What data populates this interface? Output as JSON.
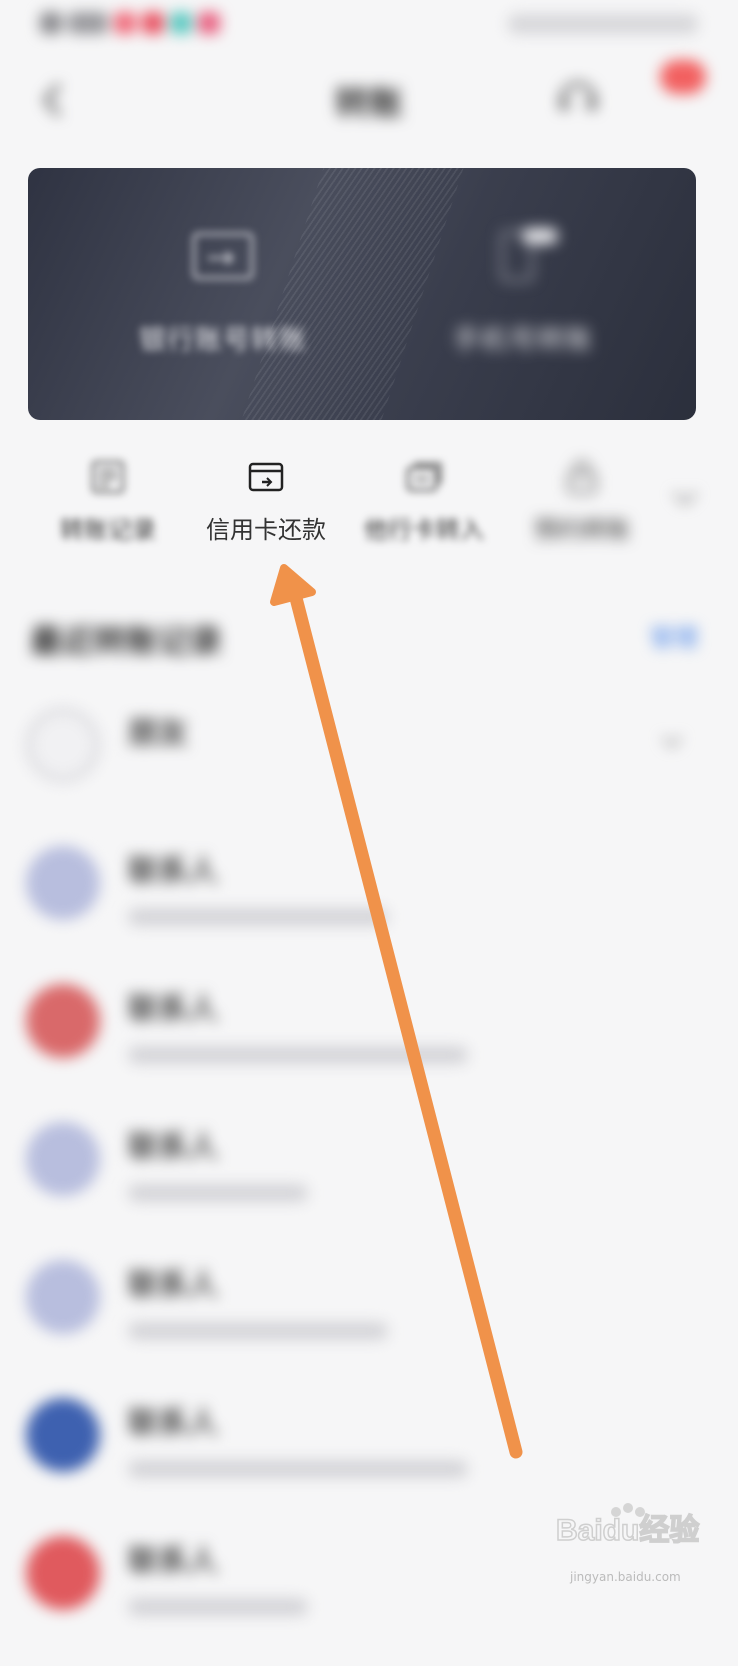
{
  "nav": {
    "title": "转账"
  },
  "banner": {
    "cards": [
      {
        "label": "银行账号转账",
        "icon": "card-transfer-icon"
      },
      {
        "label": "手机号转账",
        "icon": "phone-transfer-icon"
      }
    ]
  },
  "quick_actions": [
    {
      "label": "转账记录",
      "icon": "document-list-icon"
    },
    {
      "label": "信用卡还款",
      "icon": "credit-card-icon"
    },
    {
      "label": "他行卡转入",
      "icon": "card-swap-icon"
    },
    {
      "label": "预约转账",
      "icon": "lock-icon"
    }
  ],
  "recent": {
    "title": "最近转账记录",
    "manage_label": "管理"
  },
  "payees": [
    {
      "name": "朋友",
      "sub": "",
      "avatar_color": "#f1f1f3",
      "type": "group"
    },
    {
      "name": "联系人",
      "sub": "",
      "avatar_color": "#b8bede"
    },
    {
      "name": "联系人",
      "sub": "",
      "avatar_color": "#d9696a"
    },
    {
      "name": "联系人",
      "sub": "",
      "avatar_color": "#b8bede"
    },
    {
      "name": "联系人",
      "sub": "",
      "avatar_color": "#b8bede"
    },
    {
      "name": "联系人",
      "sub": "",
      "avatar_color": "#3e61b0"
    },
    {
      "name": "联系人",
      "sub": "",
      "avatar_color": "#e05a5e"
    }
  ],
  "colors": {
    "accent": "#4a86e8",
    "annotation_arrow": "#f0924a",
    "banner_dark": "#2f3342"
  },
  "watermark": {
    "brand": "Baidu经验",
    "url": "jingyan.baidu.com"
  }
}
